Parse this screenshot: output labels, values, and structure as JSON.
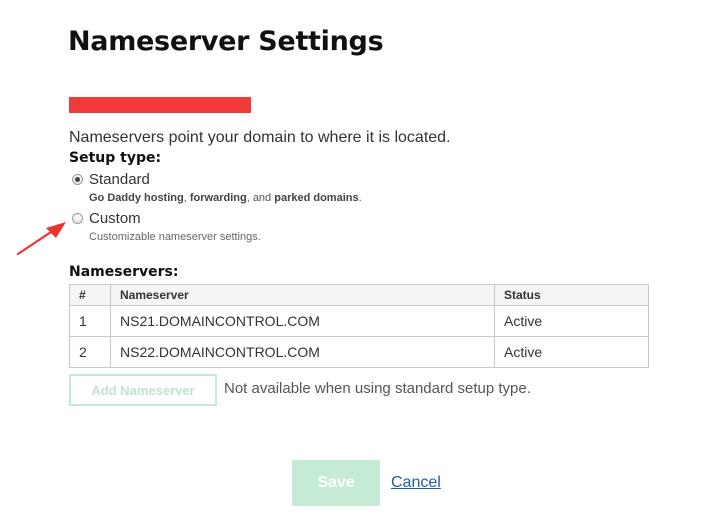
{
  "title": "Nameserver Settings",
  "intro": "Nameservers point your domain to where it is located.",
  "setup_type": {
    "label": "Setup type:",
    "options": [
      {
        "label": "Standard",
        "checked": true,
        "desc_parts": [
          "Go Daddy hosting",
          ", ",
          "forwarding",
          ", and ",
          "parked domains",
          "."
        ]
      },
      {
        "label": "Custom",
        "checked": false,
        "desc": "Customizable nameserver settings."
      }
    ]
  },
  "nameservers": {
    "label": "Nameservers:",
    "columns": [
      "#",
      "Nameserver",
      "Status"
    ],
    "rows": [
      {
        "num": "1",
        "name": "NS21.DOMAINCONTROL.COM",
        "status": "Active"
      },
      {
        "num": "2",
        "name": "NS22.DOMAINCONTROL.COM",
        "status": "Active"
      }
    ]
  },
  "add_button": {
    "label": "Add Nameserver",
    "note": "Not available when using standard setup type."
  },
  "actions": {
    "save": "Save",
    "cancel": "Cancel"
  },
  "colors": {
    "accent_disabled": "#c6ebd5",
    "link": "#1d5fab",
    "redaction": "#f23a3a",
    "arrow": "#e8352f"
  },
  "icons": {
    "annotation": "red-arrow-icon"
  }
}
